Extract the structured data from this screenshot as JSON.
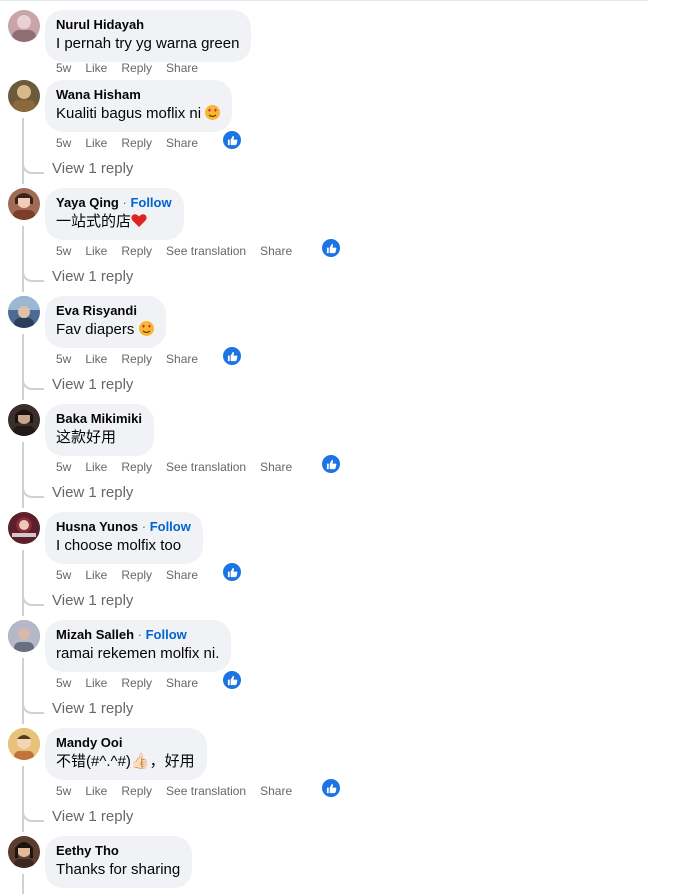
{
  "comments": [
    {
      "name": "Nurul Hidayah",
      "follow": "",
      "text": "I pernah try yg warna green",
      "time": "5w",
      "like": "Like",
      "reply": "Reply",
      "translate": "",
      "share": "Share",
      "liked": false,
      "view_reply": "",
      "avatar": "#c7a4a8"
    },
    {
      "name": "Wana Hisham",
      "follow": "",
      "text": "Kualiti bagus moflix ni",
      "emoji": "heart-eyes-emoji",
      "time": "5w",
      "like": "Like",
      "reply": "Reply",
      "translate": "",
      "share": "Share",
      "liked": true,
      "view_reply": "View 1 reply",
      "avatar": "#6b5a3c"
    },
    {
      "name": "Yaya Qing",
      "follow": "Follow",
      "text": "一站式的店",
      "emoji": "red-heart-emoji",
      "time": "5w",
      "like": "Like",
      "reply": "Reply",
      "translate": "See translation",
      "share": "Share",
      "liked": true,
      "view_reply": "View 1 reply",
      "avatar": "#a06b55"
    },
    {
      "name": "Eva Risyandi",
      "follow": "",
      "text": "Fav diapers",
      "emoji": "heart-eyes-emoji",
      "time": "5w",
      "like": "Like",
      "reply": "Reply",
      "translate": "",
      "share": "Share",
      "liked": true,
      "view_reply": "View 1 reply",
      "avatar": "#4d6a92"
    },
    {
      "name": "Baka Mikimiki",
      "follow": "",
      "text": "这款好用",
      "time": "5w",
      "like": "Like",
      "reply": "Reply",
      "translate": "See translation",
      "share": "Share",
      "liked": true,
      "view_reply": "View 1 reply",
      "avatar": "#3a2e2a"
    },
    {
      "name": "Husna Yunos",
      "follow": "Follow",
      "text": "I choose molfix too",
      "time": "5w",
      "like": "Like",
      "reply": "Reply",
      "translate": "",
      "share": "Share",
      "liked": true,
      "view_reply": "View 1 reply",
      "avatar": "#5a1f2a"
    },
    {
      "name": "Mizah Salleh",
      "follow": "Follow",
      "text": "ramai rekemen molfix ni.",
      "time": "5w",
      "like": "Like",
      "reply": "Reply",
      "translate": "",
      "share": "Share",
      "liked": true,
      "view_reply": "View 1 reply",
      "avatar": "#8a8a9a"
    },
    {
      "name": "Mandy Ooi",
      "follow": "",
      "text": "不错(#^.^#)👍🏻，好用",
      "time": "5w",
      "like": "Like",
      "reply": "Reply",
      "translate": "See translation",
      "share": "Share",
      "liked": true,
      "view_reply": "View 1 reply",
      "avatar": "#d09a4a"
    },
    {
      "name": "Eethy Tho",
      "follow": "",
      "text": "Thanks for sharing",
      "time": "",
      "like": "",
      "reply": "",
      "translate": "",
      "share": "",
      "liked": false,
      "view_reply": "",
      "avatar": "#5b3d2e"
    }
  ],
  "colors": {
    "bubble": "#f0f2f5",
    "link_blue": "#0064d1",
    "like_blue": "#1b74e4",
    "muted": "#65676b"
  }
}
